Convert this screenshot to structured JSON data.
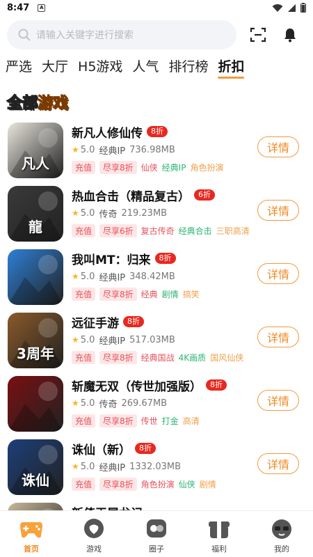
{
  "status": {
    "time": "8:47",
    "mini": "A"
  },
  "search": {
    "placeholder": "请输入关键字进行搜索"
  },
  "tabs": [
    {
      "label": "严选",
      "active": false
    },
    {
      "label": "大厅",
      "active": false
    },
    {
      "label": "H5游戏",
      "active": false
    },
    {
      "label": "人气",
      "active": false
    },
    {
      "label": "排行榜",
      "active": false
    },
    {
      "label": "折扣",
      "active": true
    }
  ],
  "section": {
    "part1": "全部",
    "part2": "游戏"
  },
  "detail_label": "详情",
  "games": [
    {
      "name": "新凡人修仙传",
      "discount": "8折",
      "score": "5.0",
      "category": "经典IP",
      "size": "736.98MB",
      "tags": [
        {
          "t": "充值",
          "c": "red"
        },
        {
          "t": "尽享8折",
          "c": "red"
        },
        {
          "t": "仙侠",
          "c": "#e8505b"
        },
        {
          "t": "经典IP",
          "c": "#2bb673"
        },
        {
          "t": "角色扮演",
          "c": "#f0a04a"
        }
      ],
      "thumb_color": "#e9e6dd",
      "thumb_text": "凡人"
    },
    {
      "name": "热血合击（精品复古）",
      "discount": "6折",
      "score": "5.0",
      "category": "传奇",
      "size": "219.23MB",
      "tags": [
        {
          "t": "充值",
          "c": "red"
        },
        {
          "t": "尽享6折",
          "c": "red"
        },
        {
          "t": "复古传奇",
          "c": "#e8505b"
        },
        {
          "t": "经典合击",
          "c": "#2bb673"
        },
        {
          "t": "三职高清",
          "c": "#f0a04a"
        }
      ],
      "thumb_color": "#3a3a3a",
      "thumb_text": "龍"
    },
    {
      "name": "我叫MT：归来",
      "discount": "8折",
      "score": "5.0",
      "category": "经典IP",
      "size": "348.42MB",
      "tags": [
        {
          "t": "充值",
          "c": "red"
        },
        {
          "t": "尽享8折",
          "c": "red"
        },
        {
          "t": "经典",
          "c": "#e8505b"
        },
        {
          "t": "剧情",
          "c": "#2bb673"
        },
        {
          "t": "搞笑",
          "c": "#f0a04a"
        }
      ],
      "thumb_color": "#2e7fd6",
      "thumb_text": ""
    },
    {
      "name": "远征手游",
      "discount": "8折",
      "score": "5.0",
      "category": "经典IP",
      "size": "517.03MB",
      "tags": [
        {
          "t": "充值",
          "c": "red"
        },
        {
          "t": "尽享8折",
          "c": "red"
        },
        {
          "t": "经典国战",
          "c": "#e8505b"
        },
        {
          "t": "4K画质",
          "c": "#2bb673"
        },
        {
          "t": "国风仙侠",
          "c": "#f0a04a"
        }
      ],
      "thumb_color": "#8a5a2a",
      "thumb_text": "3周年"
    },
    {
      "name": "斩魔无双（传世加强版）",
      "discount": "8折",
      "score": "5.0",
      "category": "传奇",
      "size": "269.67MB",
      "tags": [
        {
          "t": "充值",
          "c": "red"
        },
        {
          "t": "尽享8折",
          "c": "red"
        },
        {
          "t": "传世",
          "c": "#e8505b"
        },
        {
          "t": "打金",
          "c": "#2bb673"
        },
        {
          "t": "高清",
          "c": "#f0a04a"
        }
      ],
      "thumb_color": "#7a0f12",
      "thumb_text": ""
    },
    {
      "name": "诛仙（新）",
      "discount": "8折",
      "score": "5.0",
      "category": "经典IP",
      "size": "1332.03MB",
      "tags": [
        {
          "t": "充值",
          "c": "red"
        },
        {
          "t": "尽享8折",
          "c": "red"
        },
        {
          "t": "角色扮演",
          "c": "#e8505b"
        },
        {
          "t": "仙侠",
          "c": "#2bb673"
        },
        {
          "t": "剧情",
          "c": "#f0a04a"
        }
      ],
      "thumb_color": "#1d3f7a",
      "thumb_text": "诛仙"
    },
    {
      "name": "新倚天屠龙记",
      "discount": "",
      "score": "",
      "category": "",
      "size": "",
      "tags": [],
      "thumb_color": "#c9b89a",
      "thumb_text": ""
    }
  ],
  "nav": [
    {
      "label": "首页",
      "active": true,
      "icon": "home-icon"
    },
    {
      "label": "游戏",
      "active": false,
      "icon": "game-icon"
    },
    {
      "label": "圈子",
      "active": false,
      "icon": "circle-icon"
    },
    {
      "label": "福利",
      "active": false,
      "icon": "gift-icon"
    },
    {
      "label": "我的",
      "active": false,
      "icon": "profile-icon"
    }
  ]
}
